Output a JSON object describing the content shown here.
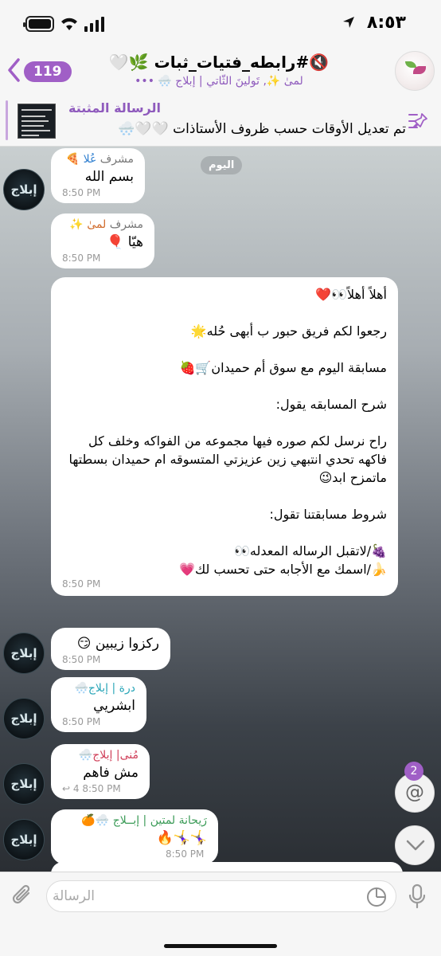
{
  "status_bar": {
    "time": "٨:٥٣"
  },
  "header": {
    "back_badge": "119",
    "title": "🔇#رابطه_فتيات_ثبات 🌿🤍",
    "subtitle": "لمىٰ ✨, تَولينَ الثّاتي | إبلاج 🌨️ •••"
  },
  "pinned": {
    "label": "الرسالة المثبتة",
    "text": "تم تعديل الأوقات حسب ظروف الأستاذات 🤍🤍🌨️"
  },
  "date_pill": "اليوم",
  "messages": [
    {
      "sender_role": "مشرف",
      "sender_name": "عُلا 🍕",
      "text": "بسم الله",
      "time": "8:50 PM"
    },
    {
      "sender_role": "مشرف",
      "sender_name": "لمىٰ ✨",
      "text": "هيّا 🎈",
      "time": "8:50 PM"
    },
    {
      "text": "أهلاً أهلاً👀❤️\n\nرجعوا لكم فريق حبور ب أبهى حُله🌟\n\nمسابقة اليوم مع سوق أم حميدان🛒🍓\n\nشرح المسابقه يقول:\n\nراح نرسل لكم صوره فيها مجموعه من الفواكه وخلف كل فاكهه تحدي انتبهي زين عزيزتي المتسوقه ام حميدان بسطتها ماتمزح ابد😉\n\nشروط مسابقتنا تقول:\n\n🍇/لاتقبل الرساله المعدله👀\n🍌/اسمك مع الأجابه حتى تحسب لك💗",
      "time": "8:50 PM"
    },
    {
      "text": "ركزوا زيبين 😏",
      "time": "8:50 PM"
    },
    {
      "sender_name": "درة | إبلاج🌨️",
      "text": "ابشريي",
      "time": "8:50 PM"
    },
    {
      "sender_name": "مُنى| إبلاج🌨️",
      "text": "مش فاهم",
      "time": "8:50 PM",
      "reply_count": "4"
    },
    {
      "sender_name": "رَيحانة لمتين | إبــلاج 🌨️🍊",
      "text": "🤸‍♀️🤸‍♀️🔥",
      "time": "8:50 PM"
    }
  ],
  "avatar_label": "إبلاج",
  "mentions": {
    "count": "2",
    "symbol": "@"
  },
  "input": {
    "placeholder": "الرسالة"
  },
  "icons": [
    "back-chevron-icon",
    "mute-icon",
    "pin-list-icon",
    "mention-icon",
    "chevron-down-icon",
    "paperclip-icon",
    "sticker-icon",
    "microphone-icon"
  ]
}
